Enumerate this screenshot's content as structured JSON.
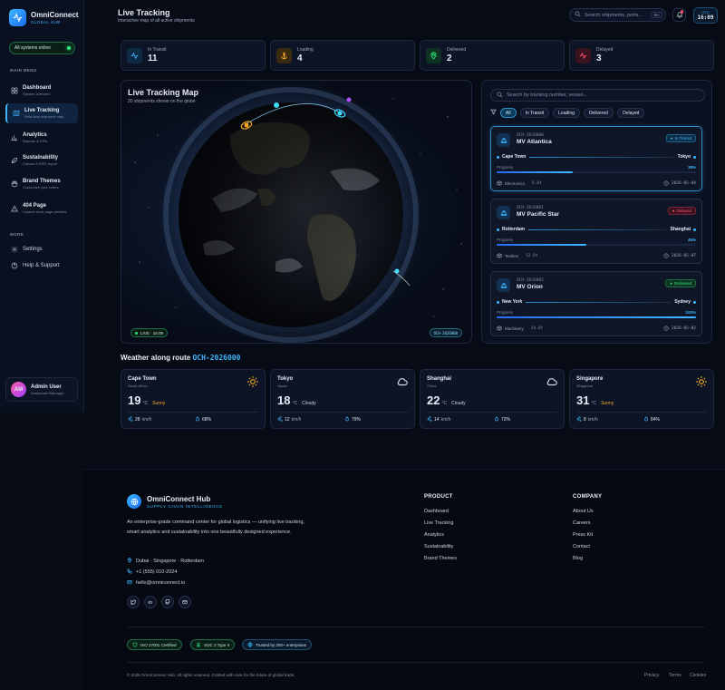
{
  "brand": {
    "name": "OmniConnect",
    "subtitle": "GLOBAL HUB"
  },
  "system_status": "All systems online",
  "sidebar": {
    "main_label": "MAIN MENU",
    "main_items": [
      {
        "title": "Dashboard",
        "sub": "System overview",
        "icon": "grid-icon"
      },
      {
        "title": "Live Tracking",
        "sub": "Real-time shipment map",
        "icon": "map-icon",
        "active": true
      },
      {
        "title": "Analytics",
        "sub": "Reports & KPIs",
        "icon": "chart-icon"
      },
      {
        "title": "Sustainability",
        "sub": "Carbon & ESG report",
        "icon": "leaf-icon"
      },
      {
        "title": "Brand Themes",
        "sub": "Customize your colors",
        "icon": "palette-icon"
      },
      {
        "title": "404 Page",
        "sub": "Custom error page preview",
        "icon": "warning-icon"
      }
    ],
    "more_label": "MORE",
    "more_items": [
      {
        "title": "Settings",
        "icon": "gear-icon"
      },
      {
        "title": "Help & Support",
        "icon": "help-icon"
      }
    ],
    "user": {
      "initials": "AM",
      "name": "Admin User",
      "role": "Dashboard Manager"
    }
  },
  "header": {
    "title": "Live Tracking",
    "subtitle": "Interactive map of all active shipments",
    "search_placeholder": "Search shipments, ports...",
    "search_shortcut": "⌘K",
    "utc_label": "UTC",
    "utc_time": "16:09"
  },
  "stats": [
    {
      "label": "In Transit",
      "value": "11",
      "color": "#3fb6ff",
      "icon": "pulse-icon"
    },
    {
      "label": "Loading",
      "value": "4",
      "color": "#f5a623",
      "icon": "anchor-icon"
    },
    {
      "label": "Delivered",
      "value": "2",
      "color": "#2ee87a",
      "icon": "pin-icon"
    },
    {
      "label": "Delayed",
      "value": "3",
      "color": "#ff4d6d",
      "icon": "pulse-icon"
    }
  ],
  "map": {
    "title": "Live Tracking Map",
    "subtitle": "20 shipments shown on the globe",
    "live_label": "LIVE · 16:09",
    "ref_label": "OCH-2026000"
  },
  "shipments": {
    "search_placeholder": "Search by tracking number, vessel...",
    "filters": [
      "All",
      "In Transit",
      "Loading",
      "Delivered",
      "Delayed"
    ],
    "active_filter": "All",
    "items": [
      {
        "id": "OCH-2026000",
        "vessel": "MV Atlantica",
        "status": "In Transit",
        "status_color": "#3fb6ff",
        "origin": "Cape Town",
        "destination": "Tokyo",
        "progress_label": "Progress",
        "progress_pct": "38%",
        "progress": 0.38,
        "cargo": "Electronics",
        "weight": "6.8t",
        "eta": "2026-05-04",
        "selected": true
      },
      {
        "id": "OCH-2026001",
        "vessel": "MV Pacific Star",
        "status": "Delayed",
        "status_color": "#ff4d6d",
        "origin": "Rotterdam",
        "destination": "Shanghai",
        "progress_label": "Progress",
        "progress_pct": "45%",
        "progress": 0.45,
        "cargo": "Textiles",
        "weight": "52.6t",
        "eta": "2026-05-07"
      },
      {
        "id": "OCH-2026002",
        "vessel": "MV Orion",
        "status": "Delivered",
        "status_color": "#2ee87a",
        "origin": "New York",
        "destination": "Sydney",
        "progress_label": "Progress",
        "progress_pct": "100%",
        "progress": 1.0,
        "cargo": "Machinery",
        "weight": "34.8t",
        "eta": "2026-05-02"
      }
    ]
  },
  "weather": {
    "heading": "Weather along route",
    "route_ref": "OCH-2026000",
    "cities": [
      {
        "city": "Cape Town",
        "country": "South Africa",
        "temp": "19",
        "unit": "°C",
        "condition": "Sunny",
        "wind": "28",
        "wind_unit": "km/h",
        "humidity": "68%",
        "icon": "sun-icon"
      },
      {
        "city": "Tokyo",
        "country": "Japan",
        "temp": "18",
        "unit": "°C",
        "condition": "Cloudy",
        "wind": "12",
        "wind_unit": "km/h",
        "humidity": "79%",
        "icon": "cloud-icon"
      },
      {
        "city": "Shanghai",
        "country": "China",
        "temp": "22",
        "unit": "°C",
        "condition": "Cloudy",
        "wind": "14",
        "wind_unit": "km/h",
        "humidity": "72%",
        "icon": "cloud-icon"
      },
      {
        "city": "Singapore",
        "country": "Singapore",
        "temp": "31",
        "unit": "°C",
        "condition": "Sunny",
        "wind": "8",
        "wind_unit": "km/h",
        "humidity": "84%",
        "icon": "sun-icon"
      }
    ]
  },
  "footer": {
    "brand_name": "OmniConnect Hub",
    "brand_tagline": "SUPPLY CHAIN INTELLIGENCE",
    "description": "An enterprise-grade command center for global logistics — unifying live tracking, smart analytics and sustainability into one beautifully designed experience.",
    "locations": "Dubai · Singapore · Rotterdam",
    "phone": "+1 (555) 010-2024",
    "email": "hello@omniconnect.io",
    "social_icons": [
      "twitter-icon",
      "linkedin-icon",
      "github-icon",
      "mail-icon"
    ],
    "product_title": "PRODUCT",
    "product_links": [
      "Dashboard",
      "Live Tracking",
      "Analytics",
      "Sustainability",
      "Brand Themes"
    ],
    "company_title": "COMPANY",
    "company_links": [
      "About Us",
      "Careers",
      "Press Kit",
      "Contact",
      "Blog"
    ],
    "certs": [
      "ISO 27001 Certified",
      "SOC 2 Type II",
      "Trusted by 200+ enterprises"
    ],
    "copyright": "© 2026 OmniConnect Hub. All rights reserved. Crafted with care for the future of global trade.",
    "legal": [
      "Privacy",
      "Terms",
      "Cookies"
    ]
  }
}
